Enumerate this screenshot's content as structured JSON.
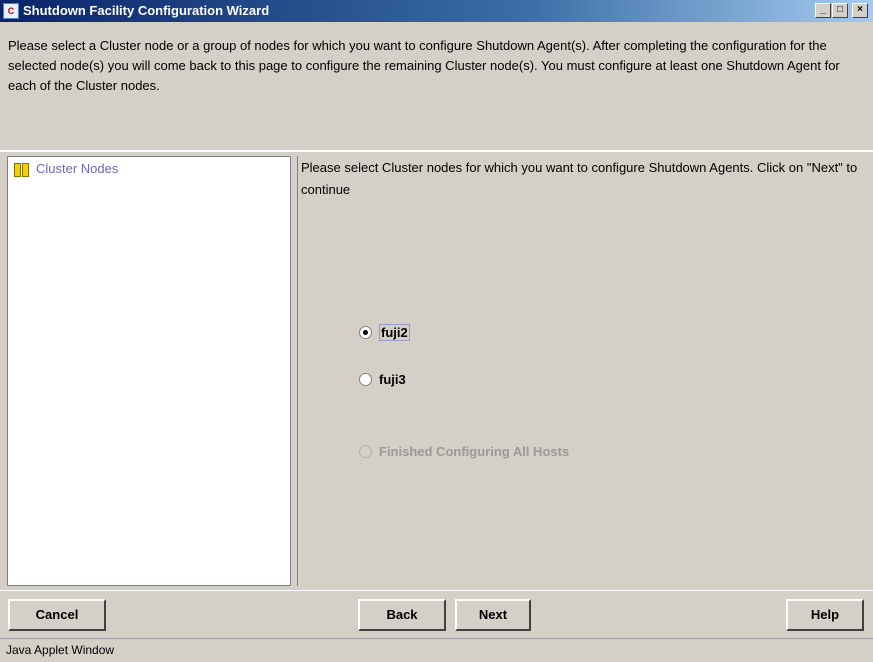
{
  "window": {
    "title": "Shutdown Facility Configuration Wizard",
    "icon": "java-cluster-app-icon",
    "controls": {
      "minimize": "_",
      "maximize": "□",
      "close": "×"
    }
  },
  "instructions": "Please select a Cluster node or a group of nodes for which you want to configure Shutdown Agent(s). After completing the configuration for the selected node(s) you will come back to this page to configure the remaining Cluster node(s). You must configure at least one Shutdown Agent for each of the Cluster nodes.",
  "tree": {
    "root_label": "Cluster Nodes",
    "root_icon": "book-icon"
  },
  "prompt": "Please select Cluster nodes for which you want to configure Shutdown Agents. Click on \"Next\" to continue",
  "options": [
    {
      "label": "fuji2",
      "selected": true,
      "enabled": true
    },
    {
      "label": "fuji3",
      "selected": false,
      "enabled": true
    },
    {
      "label": "Finished Configuring All Hosts",
      "selected": false,
      "enabled": false
    }
  ],
  "buttons": {
    "cancel": "Cancel",
    "back": "Back",
    "next": "Next",
    "help": "Help"
  },
  "status_bar": "Java Applet Window",
  "colors": {
    "titlebar_start": "#0a246a",
    "titlebar_end": "#a6caf0",
    "tree_label": "#6a6ab8",
    "background": "#d4d0c8"
  }
}
